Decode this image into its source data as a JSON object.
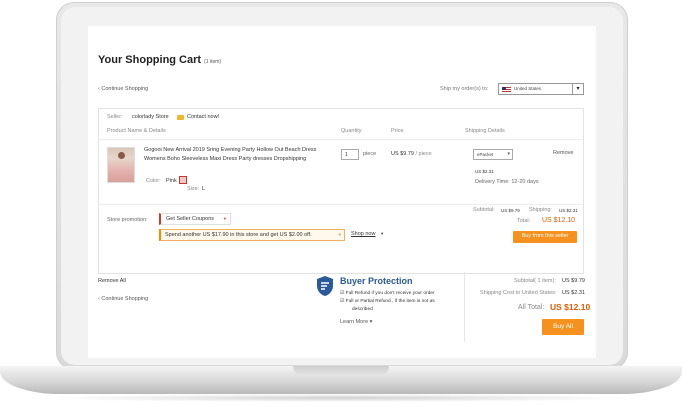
{
  "cart": {
    "title": "Your Shopping Cart",
    "item_count": "(1 item)",
    "continue_shopping": "‹ Continue Shopping",
    "ship_to_label": "Ship my order(s) to:",
    "ship_to_country": "United States"
  },
  "store": {
    "seller_label": "Seller:",
    "seller_name": "colorlady Store",
    "contact_label": "Contact now!",
    "columns": [
      "Product Name & Details",
      "Quantity",
      "Price",
      "Shipping Details"
    ],
    "item": {
      "title": "Gogooi New Arrival 2019 Sring Evening Party Hollow Out Beach Dress Womens Boho Sleeveless Maxi Dress Party dresses Dropshipping",
      "color_label": "Color:",
      "color_value": "Pink",
      "size_label": "Size:",
      "size_value": "L",
      "quantity": "1",
      "quantity_unit": "piece",
      "price": "US $9.79",
      "price_unit": "/ piece",
      "shipping_method": "ePacket",
      "shipping_cost": "US $2.31",
      "delivery_time": "Delivery Time: 12-20 days",
      "remove_label": "Remove"
    },
    "promotion_label": "Store promotion:",
    "coupon_label": "Get Seller Coupons",
    "spend_text": "Spend another US $17.90 in this store and get US $2.00 off.",
    "shop_now": "Shop now",
    "subtotal_label": "Subtotal:",
    "subtotal_value": "US $9.79",
    "shipping_label": "Shipping:",
    "shipping_value": "US $2.31",
    "total_label": "Total:",
    "total_value": "US $12.10",
    "buy_store_label": "Buy from this seller"
  },
  "footer": {
    "remove_all": "Remove All",
    "continue_shopping": "‹ Continue Shopping",
    "protection_title": "Buyer Protection",
    "protection_line1": "Full Refund if you don't receive your order",
    "protection_line2": "Full or Partial Refund , if the item is not as",
    "protection_line3": "described",
    "learn_more": "Learn More ▾",
    "summary_subtotal_label": "Subtotal( 1 item):",
    "summary_subtotal_value": "US $9.79",
    "summary_shipping_label": "Shipping Cost to United States:",
    "summary_shipping_value": "US $2.31",
    "summary_total_label": "All Total:",
    "summary_total_value": "US $12.10",
    "buy_all_label": "Buy All"
  },
  "colors": {
    "accent_orange": "#f5921f",
    "total_orange": "#e05a00",
    "protection_blue": "#2b5a9a",
    "coupon_red": "#d8342a"
  },
  "icons": [
    "mail-icon",
    "flag-icon",
    "chevron-down-icon",
    "shield-icon",
    "checkbox-icon"
  ]
}
